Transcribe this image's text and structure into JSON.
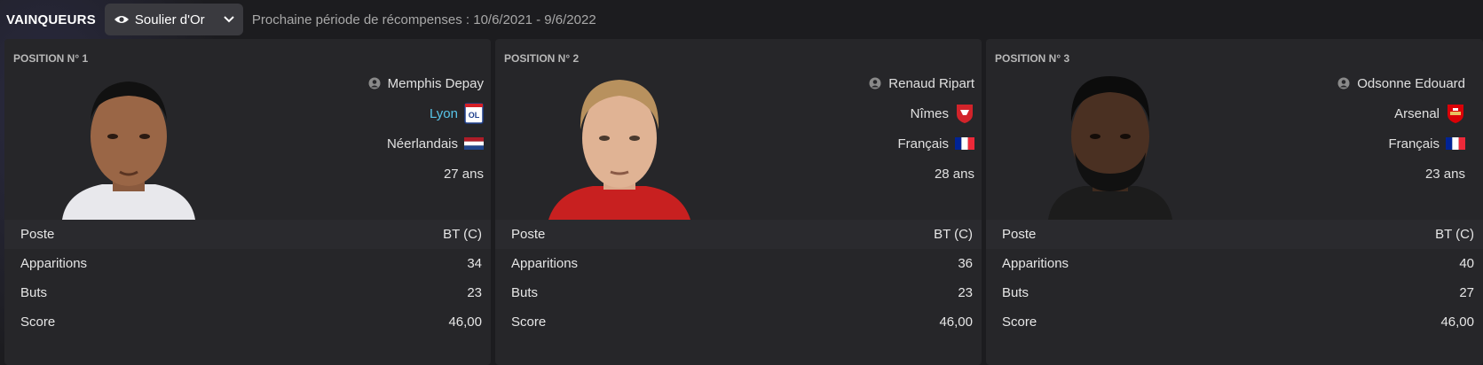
{
  "header": {
    "title": "VAINQUEURS",
    "award_select": "Soulier d'Or",
    "period": "Prochaine période de récompenses : 10/6/2021 - 9/6/2022"
  },
  "colors": {
    "accent_link": "#58c4e8",
    "background": "#1c1c1f"
  },
  "stat_labels": {
    "position": "Poste",
    "appearances": "Apparitions",
    "goals": "Buts",
    "score": "Score"
  },
  "winners": [
    {
      "rank_label": "POSITION N° 1",
      "name": "Memphis Depay",
      "club": "Lyon",
      "club_icon": "lyon-crest-icon",
      "nationality": "Néerlandais",
      "flag_icon": "netherlands-flag-icon",
      "age": "27 ans",
      "poste": "BT (C)",
      "apparitions": "34",
      "buts": "23",
      "score": "46,00"
    },
    {
      "rank_label": "POSITION N° 2",
      "name": "Renaud Ripart",
      "club": "Nîmes",
      "club_icon": "nimes-crest-icon",
      "nationality": "Français",
      "flag_icon": "france-flag-icon",
      "age": "28 ans",
      "poste": "BT (C)",
      "apparitions": "36",
      "buts": "23",
      "score": "46,00"
    },
    {
      "rank_label": "POSITION N° 3",
      "name": "Odsonne Edouard",
      "club": "Arsenal",
      "club_icon": "arsenal-crest-icon",
      "nationality": "Français",
      "flag_icon": "france-flag-icon",
      "age": "23 ans",
      "poste": "BT (C)",
      "apparitions": "40",
      "buts": "27",
      "score": "46,00"
    }
  ]
}
